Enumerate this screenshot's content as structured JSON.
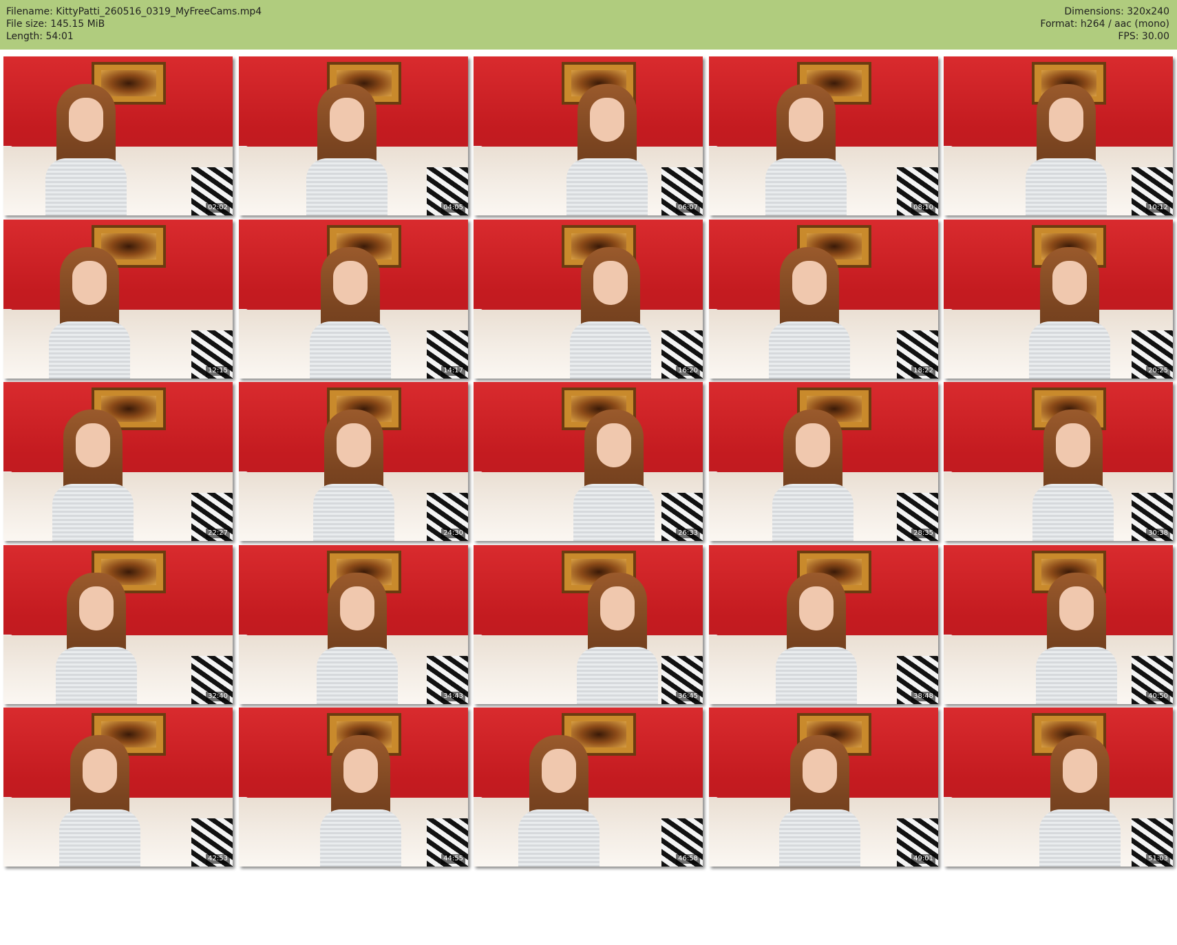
{
  "header": {
    "filename": "Filename: KittyPatti_260516_0319_MyFreeCams.mp4",
    "filesize": "File size: 145.15 MiB",
    "length": "Length: 54:01",
    "dimensions": "Dimensions: 320x240",
    "format": "Format: h264 / aac (mono)",
    "fps": "FPS: 30.00"
  },
  "colors": {
    "header_bg": "#b0cc7e",
    "wall": "#c81e22"
  },
  "thumbnails": [
    {
      "timestamp": "02:02"
    },
    {
      "timestamp": "04:05"
    },
    {
      "timestamp": "06:07"
    },
    {
      "timestamp": "08:10"
    },
    {
      "timestamp": "10:12"
    },
    {
      "timestamp": "12:15"
    },
    {
      "timestamp": "14:17"
    },
    {
      "timestamp": "16:20"
    },
    {
      "timestamp": "18:22"
    },
    {
      "timestamp": "20:25"
    },
    {
      "timestamp": "22:27"
    },
    {
      "timestamp": "24:30"
    },
    {
      "timestamp": "26:33"
    },
    {
      "timestamp": "28:35"
    },
    {
      "timestamp": "30:38"
    },
    {
      "timestamp": "32:40"
    },
    {
      "timestamp": "34:43"
    },
    {
      "timestamp": "36:45"
    },
    {
      "timestamp": "38:48"
    },
    {
      "timestamp": "40:50"
    },
    {
      "timestamp": "42:53"
    },
    {
      "timestamp": "44:55"
    },
    {
      "timestamp": "46:58"
    },
    {
      "timestamp": "49:01"
    },
    {
      "timestamp": "51:03"
    }
  ]
}
